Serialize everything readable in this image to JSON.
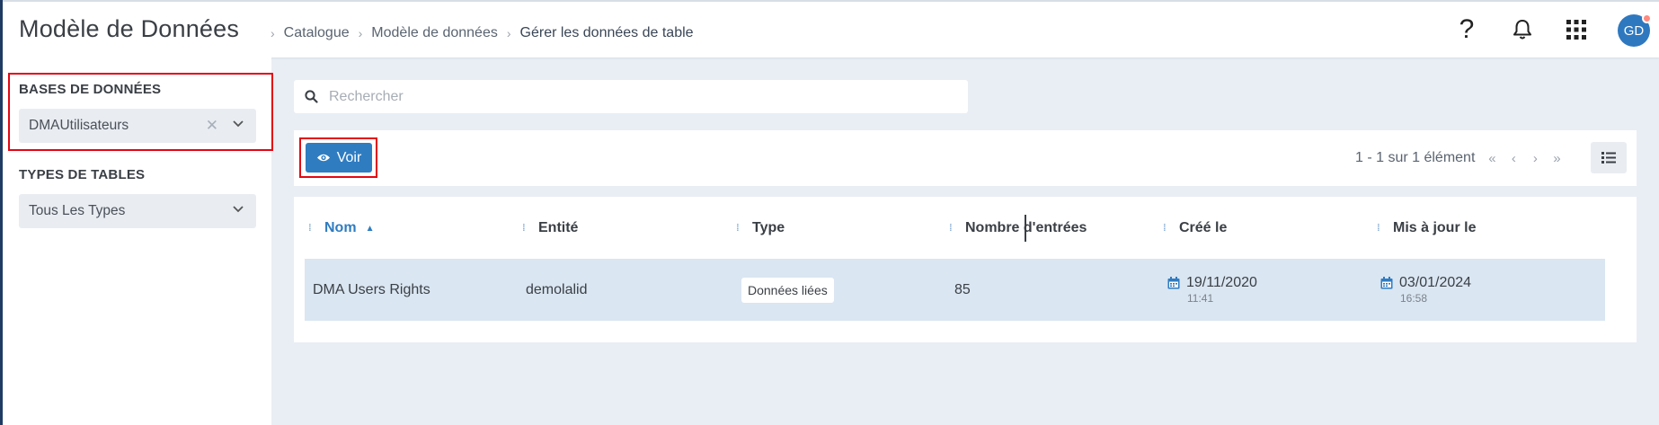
{
  "app": {
    "title": "Modèle de Données"
  },
  "breadcrumb": [
    "Catalogue",
    "Modèle de données",
    "Gérer les données de table"
  ],
  "header": {
    "help_symbol": "?",
    "avatar_initials": "GD"
  },
  "sidebar": {
    "databases_label": "BASES DE DONNÉES",
    "database_selected": "DMAUtilisateurs",
    "table_types_label": "TYPES DE TABLES",
    "table_type_selected": "Tous Les Types"
  },
  "search": {
    "placeholder": "Rechercher",
    "value": ""
  },
  "toolbar": {
    "voir_label": "Voir",
    "pagination_text": "1 - 1 sur 1 élément"
  },
  "grid": {
    "columns": [
      "Nom",
      "Entité",
      "Type",
      "Nombre d'entrées",
      "Créé le",
      "Mis à jour le"
    ],
    "sorted_column": "Nom",
    "sort_direction": "ascending",
    "rows": [
      {
        "nom": "DMA Users Rights",
        "entite": "demolalid",
        "type": "Données liées",
        "nombre_entrees": "85",
        "cree_le_date": "19/11/2020",
        "cree_le_time": "11:41",
        "mis_a_jour_date": "03/01/2024",
        "mis_a_jour_time": "16:58"
      }
    ]
  },
  "colors": {
    "accent": "#2f7cc1",
    "highlight_border": "#e30613",
    "selected_row": "#dae6f2",
    "page_background": "#e9eef5"
  },
  "icons": [
    "search-icon",
    "eye-icon",
    "help-icon",
    "bell-icon",
    "apps-grid-icon",
    "list-view-icon",
    "calendar-icon",
    "chevron-down-icon",
    "clear-icon",
    "drag-handle-icon",
    "sort-ascending-icon"
  ]
}
